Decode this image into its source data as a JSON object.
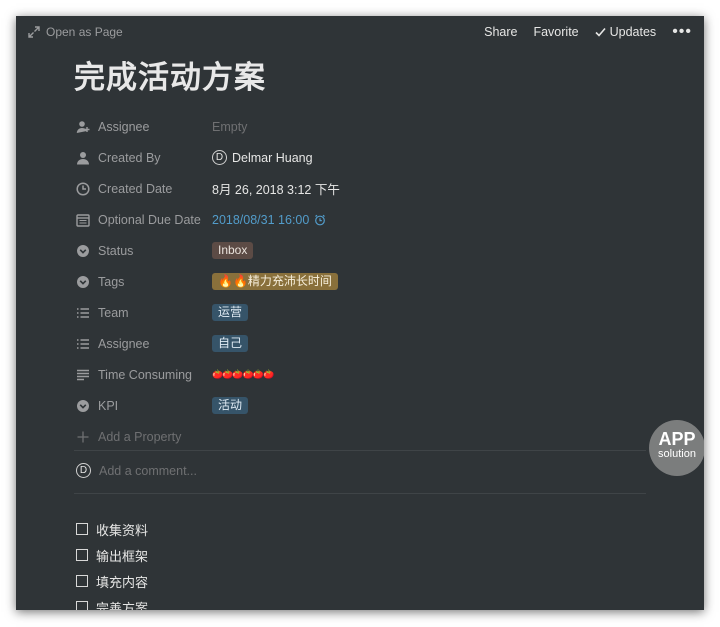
{
  "topbar": {
    "open_as_page": "Open as Page",
    "share": "Share",
    "favorite": "Favorite",
    "updates": "Updates",
    "more": "•••"
  },
  "page": {
    "title": "完成活动方案"
  },
  "properties": [
    {
      "name": "Assignee",
      "icon": "person-add-icon",
      "value": "Empty"
    },
    {
      "name": "Created By",
      "icon": "person-icon",
      "value": "Delmar Huang",
      "avatar": "D"
    },
    {
      "name": "Created Date",
      "icon": "clock-icon",
      "value": "8月 26, 2018 3:12 下午"
    },
    {
      "name": "Optional Due Date",
      "icon": "calendar-icon",
      "value": "2018/08/31 16:00"
    },
    {
      "name": "Status",
      "icon": "select-icon",
      "value": "Inbox"
    },
    {
      "name": "Tags",
      "icon": "select-icon",
      "value": "🔥🔥精力充沛长时间"
    },
    {
      "name": "Team",
      "icon": "list-icon",
      "value": "运营"
    },
    {
      "name": "Assignee",
      "icon": "list-icon",
      "value": "自己"
    },
    {
      "name": "Time Consuming",
      "icon": "text-icon",
      "value": "🍅🍅🍅🍅🍅🍅"
    },
    {
      "name": "KPI",
      "icon": "select-icon",
      "value": "活动"
    }
  ],
  "add_property": "Add a Property",
  "comment": {
    "avatar": "D",
    "placeholder": "Add a comment..."
  },
  "todos": [
    "收集资料",
    "输出框架",
    "填充内容",
    "完善方案"
  ],
  "watermark": {
    "top": "APP",
    "bottom": "solution"
  },
  "colors": {
    "background": "#2f3437",
    "link": "#529cca",
    "tag_brown": "#5c4b45",
    "tag_yellow": "#89703b",
    "tag_blue": "#365469"
  }
}
